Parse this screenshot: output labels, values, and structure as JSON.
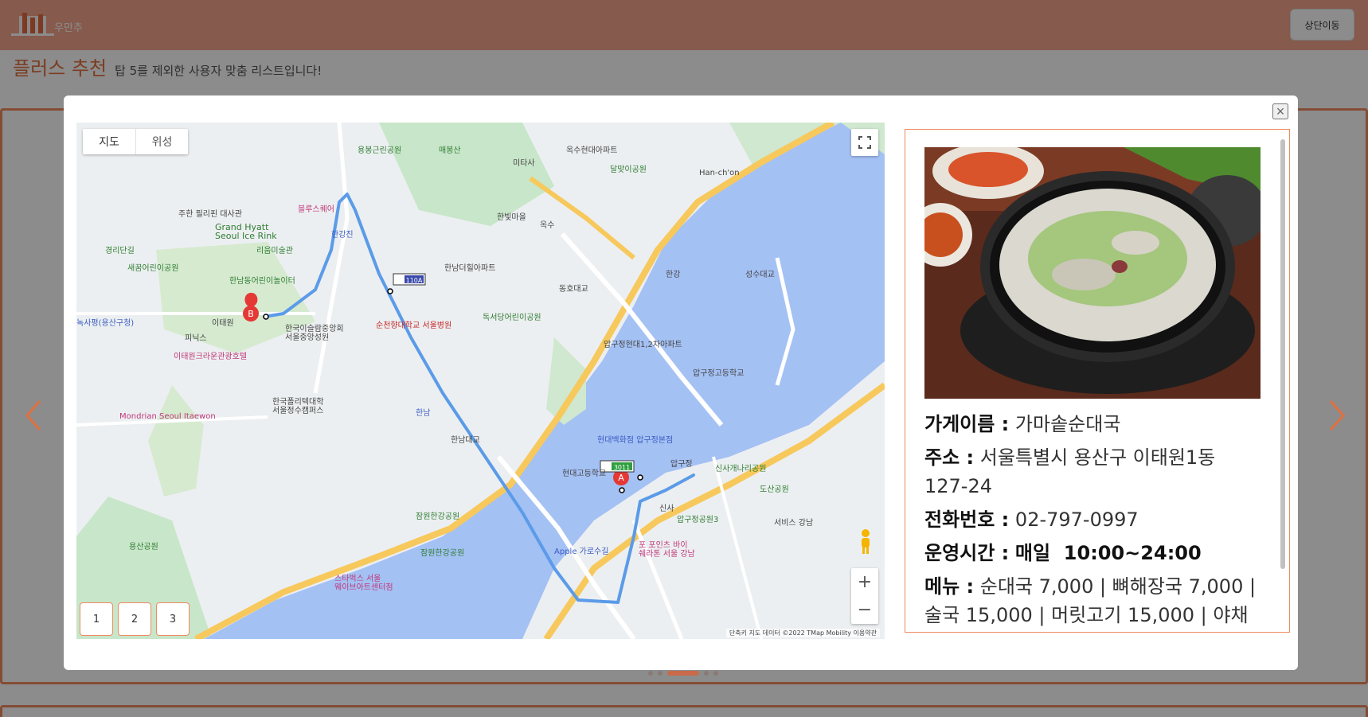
{
  "brand": {
    "name": "우만추"
  },
  "navbar": {
    "top_button": "상단이동"
  },
  "page": {
    "title": "플러스 추천",
    "subtitle": "탑 5를 제외한 사용자 맞춤 리스트입니다!"
  },
  "modal": {
    "close": "×",
    "map": {
      "type_tabs": [
        "지도",
        "위성"
      ],
      "route_buttons": [
        "1",
        "2",
        "3"
      ],
      "copyright": "단축키   지도 데이터 ©2022 TMap Mobility   이용약관",
      "markers": {
        "start": "A",
        "end": "B"
      },
      "bus_labels": [
        "110A",
        "3011"
      ],
      "labels": {
        "yongbong": "용봉근린공원",
        "maebong": "매봉산",
        "oksu_apt": "옥수현대아파트",
        "mitasa": "미타사",
        "dalmaji": "달맞이공원",
        "hanchon": "Han-ch'on",
        "philippine": "주한 필리핀 대사관",
        "bluesquare": "블루스퀘어",
        "grand_hyatt": "Grand Hyatt\nSeoul Ice Rink",
        "gyeongridan": "경리단길",
        "leeum": "리움미술관",
        "hanganjin": "한강진",
        "saeggum": "새꿈어린이공원",
        "hannam_park": "한남동어린이놀이터",
        "hannam_hill": "한남더힐아파트",
        "hanbitmaeul": "한빛마을",
        "oksu": "옥수",
        "dongho": "동호대교",
        "hangang": "한강",
        "seongsu": "성수대교",
        "itaewon": "이태원",
        "hwangnoksa": "녹사평(용산구청)",
        "pinix": "피닉스",
        "soonchunhyang": "순천향대학교 서울병원",
        "osaek": "독서당어린이공원",
        "islamic": "한국이슬람중앙회\n서울중앙성원",
        "itaewon_crown": "이태원크라운관광호텔",
        "apgujeong_apt": "압구정현대1,2차아파트",
        "apgujeong_hs": "압구정고등학교",
        "mondrian": "Mondrian Seoul Itaewon",
        "polytech": "한국폴리텍대학\n서울정수캠퍼스",
        "hannam": "한남",
        "hannam_bridge": "한남대교",
        "hyundai_dept": "현대백화점 압구정본점",
        "hyundai_hs": "현대고등학교",
        "apgujeong": "압구정",
        "sinsa_park": "신사개나리공원",
        "dosan": "도산공원",
        "jamwon": "잠원한강공원",
        "apgujeong_park": "압구정공원3",
        "yongsan_park": "용산공원",
        "apple": "Apple 가로수길",
        "four_points": "포 포인츠 바이\n쉐라톤 서울 강남",
        "jamwon2": "잠원한강공원",
        "starbucks": "스타벅스 서울\n웨이브아트센터점",
        "sinsa": "신사",
        "services": "서비스 강남"
      }
    },
    "info": {
      "fields": [
        {
          "label": "가게이름 :",
          "value": "가마솥순대국"
        },
        {
          "label": "주소 :",
          "value": "서울특별시 용산구 이태원1동 127-24"
        },
        {
          "label": "전화번호 :",
          "value": "02-797-0997"
        },
        {
          "label": "운영시간 :",
          "value": "매일  10:00~24:00"
        },
        {
          "label": "메뉴 :",
          "value": "순대국 7,000 | 뼈해장국 7,000 | 술국 15,000 | 머릿고기 15,000 | 야채"
        }
      ]
    }
  },
  "carousel": {
    "dots": 5,
    "active": 2
  },
  "colors": {
    "accent": "#f5a58a",
    "border": "#f08a60",
    "title": "#e0703f",
    "route": "#5b9be8",
    "water": "#a4c1f4"
  }
}
